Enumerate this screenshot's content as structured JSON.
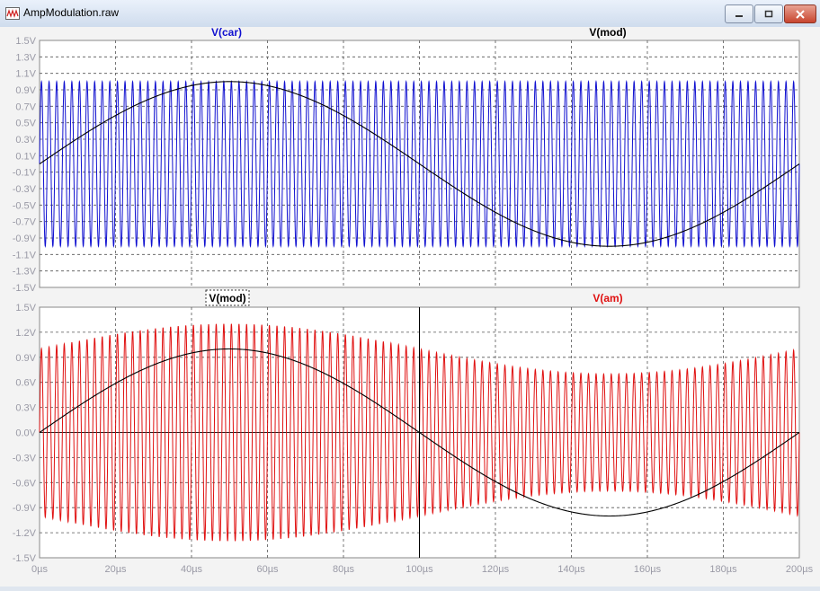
{
  "window": {
    "title": "AmpModulation.raw"
  },
  "colors": {
    "car": "#1010d0",
    "am": "#e01010",
    "mod": "#000000",
    "grid": "#555555",
    "axis_text": "#9a9aa6"
  },
  "chart_data": [
    {
      "type": "line",
      "pane": "top",
      "series": [
        {
          "name": "V(car)",
          "color": "#1010d0",
          "function": "sine",
          "amplitude": 1.0,
          "cycles": 100
        },
        {
          "name": "V(mod)",
          "color": "#000000",
          "function": "sine",
          "amplitude": 1.0,
          "cycles": 1
        }
      ],
      "xlim": [
        0,
        200
      ],
      "x_unit": "µs",
      "ylim": [
        -1.5,
        1.5
      ],
      "yticks": [
        "1.5V",
        "1.3V",
        "1.1V",
        "0.9V",
        "0.7V",
        "0.5V",
        "0.3V",
        "0.1V",
        "-0.1V",
        "-0.3V",
        "-0.5V",
        "-0.7V",
        "-0.9V",
        "-1.1V",
        "-1.3V",
        "-1.5V"
      ],
      "grid": true
    },
    {
      "type": "line",
      "pane": "bottom",
      "series": [
        {
          "name": "V(mod)",
          "color": "#000000",
          "function": "sine",
          "amplitude": 1.0,
          "cycles": 1
        },
        {
          "name": "V(am)",
          "color": "#e01010",
          "function": "am",
          "amplitude": 1.0,
          "mod_index": 0.3,
          "cycles": 100
        }
      ],
      "xlim": [
        0,
        200
      ],
      "x_unit": "µs",
      "ylim": [
        -1.5,
        1.5
      ],
      "yticks": [
        "1.5V",
        "1.2V",
        "0.9V",
        "0.6V",
        "0.3V",
        "0.0V",
        "-0.3V",
        "-0.6V",
        "-0.9V",
        "-1.2V",
        "-1.5V"
      ],
      "xticks": [
        "0µs",
        "20µs",
        "40µs",
        "60µs",
        "80µs",
        "100µs",
        "120µs",
        "140µs",
        "160µs",
        "180µs",
        "200µs"
      ],
      "cursor_x": 100,
      "grid": true
    }
  ]
}
